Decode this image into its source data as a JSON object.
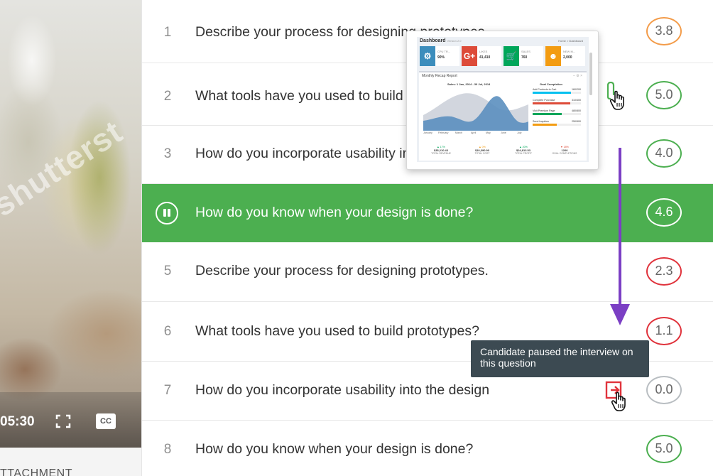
{
  "video": {
    "watermark": "shutterst",
    "time": "05:30",
    "cc_label": "CC",
    "attachment_label": "TTACHMENT"
  },
  "questions": [
    {
      "num": "1",
      "text": "Describe your process for designing prototypes.",
      "score": "3.8",
      "color": "#f39c4a"
    },
    {
      "num": "2",
      "text": "What tools have you used to build prototypes?",
      "score": "5.0",
      "color": "#4caf50"
    },
    {
      "num": "3",
      "text": "How do you incorporate usability into the design",
      "score": "4.0",
      "color": "#4caf50"
    },
    {
      "num": "4",
      "text": "How do you know when your design is done?",
      "score": "4.6",
      "color": "#ffffff"
    },
    {
      "num": "5",
      "text": "Describe your process for designing prototypes.",
      "score": "2.3",
      "color": "#e0333c"
    },
    {
      "num": "6",
      "text": "What tools have you used to build prototypes?",
      "score": "1.1",
      "color": "#e0333c"
    },
    {
      "num": "7",
      "text": "How do you incorporate usability into the design",
      "score": "0.0",
      "color": "#b9bec2"
    },
    {
      "num": "8",
      "text": "How do you know when your design is done?",
      "score": "5.0",
      "color": "#4caf50"
    }
  ],
  "active_question_index": 3,
  "tooltip": {
    "text": "Candidate paused the interview on this question"
  },
  "dashboard_preview": {
    "title": "Dashboard",
    "subtitle": "Version 2.0",
    "breadcrumb": "Home > Dashboard",
    "kpis": [
      {
        "icon": "gear-icon",
        "label": "CPU TR...",
        "value": "90%",
        "color": "#3c8dbc"
      },
      {
        "icon": "google-plus-icon",
        "label": "LIKES",
        "value": "41,410",
        "color": "#dd4b39"
      },
      {
        "icon": "cart-icon",
        "label": "SALES",
        "value": "760",
        "color": "#00a65a"
      },
      {
        "icon": "users-icon",
        "label": "NEW M...",
        "value": "2,000",
        "color": "#f39c12"
      }
    ],
    "report_title": "Monthly Recap Report",
    "sales_title": "Sales: 1 Jan, 2014 - 30 Jul, 2014",
    "months": [
      "January",
      "February",
      "March",
      "April",
      "May",
      "June",
      "July"
    ],
    "goal_title": "Goal Completion",
    "goals": [
      {
        "label": "Add Products to Cart",
        "value": "160/200",
        "pct": 0.8,
        "color": "#00c0ef"
      },
      {
        "label": "Complete Purchase",
        "value": "310/400",
        "pct": 0.78,
        "color": "#dd4b39"
      },
      {
        "label": "Visit Premium Page",
        "value": "480/800",
        "pct": 0.6,
        "color": "#00a65a"
      },
      {
        "label": "Send Inquiries",
        "value": "250/500",
        "pct": 0.5,
        "color": "#f39c12"
      }
    ],
    "stats": [
      {
        "pct": "▲ 17%",
        "amount": "$35,210.43",
        "label": "TOTAL REVENUE",
        "color": "#00a65a"
      },
      {
        "pct": "▲ 0%",
        "amount": "$10,390.90",
        "label": "TOTAL COST",
        "color": "#f39c12"
      },
      {
        "pct": "▲ 20%",
        "amount": "$24,813.53",
        "label": "TOTAL PROFIT",
        "color": "#00a65a"
      },
      {
        "pct": "▼ 18%",
        "amount": "1200",
        "label": "GOAL COMPLETIONS",
        "color": "#dd4b39"
      }
    ]
  }
}
